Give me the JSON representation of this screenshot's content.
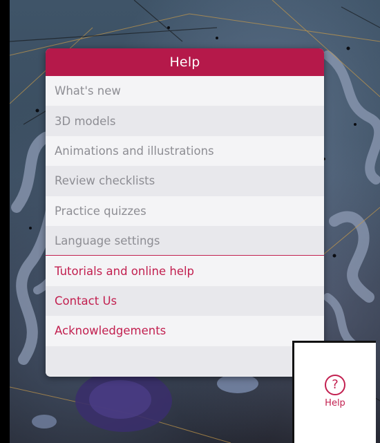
{
  "colors": {
    "accent": "#c21f4f",
    "header_bg": "#b5194a",
    "menu_text_gray": "#8d8d93",
    "menu_bg_light": "#f4f4f6",
    "menu_bg_alt": "#e8e8ec"
  },
  "help_menu": {
    "title": "Help",
    "items": [
      {
        "label": "What's new",
        "style": "gray"
      },
      {
        "label": "3D models",
        "style": "gray"
      },
      {
        "label": "Animations and illustrations",
        "style": "gray"
      },
      {
        "label": "Review checklists",
        "style": "gray"
      },
      {
        "label": "Practice quizzes",
        "style": "gray"
      },
      {
        "label": "Language settings",
        "style": "gray"
      },
      {
        "label": "Tutorials and online help",
        "style": "accent"
      },
      {
        "label": "Contact Us",
        "style": "accent"
      },
      {
        "label": "Acknowledgements",
        "style": "accent"
      }
    ]
  },
  "help_tab": {
    "icon": "question-circle-icon",
    "icon_glyph": "?",
    "label": "Help"
  }
}
